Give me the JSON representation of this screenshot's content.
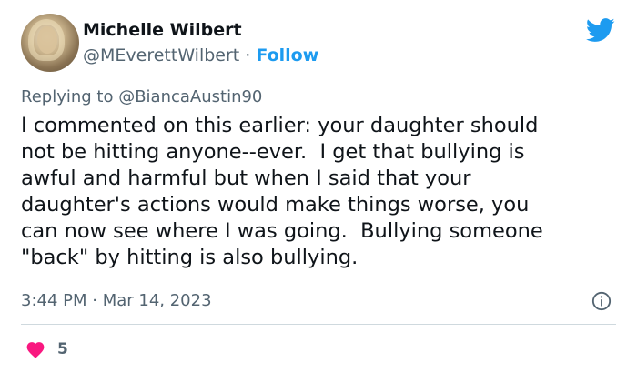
{
  "author": {
    "name": "Michelle Wilbert",
    "handle": "@MEverettWilbert",
    "separator": " · ",
    "follow_label": "Follow"
  },
  "reply": {
    "prefix": "Replying to ",
    "handle": "@BiancaAustin90"
  },
  "tweet": {
    "lines": [
      "I commented on this earlier: your daughter should",
      "not be hitting anyone--ever.  I get that bullying is",
      "awful and harmful but when I said that your",
      "daughter's actions would make things worse, you",
      "can now see where I was going.  Bullying someone",
      "\"back\" by hitting is also bullying."
    ]
  },
  "meta": {
    "timestamp": "3:44 PM · Mar 14, 2023"
  },
  "engagement": {
    "likes": "5"
  },
  "icons": {
    "platform": "twitter-bird-icon",
    "info": "info-icon",
    "like": "heart-icon"
  },
  "colors": {
    "accent": "#1d9bf0",
    "like": "#f91880",
    "secondary_text": "#536471",
    "primary_text": "#0f1419",
    "divider": "#cfd9de"
  }
}
